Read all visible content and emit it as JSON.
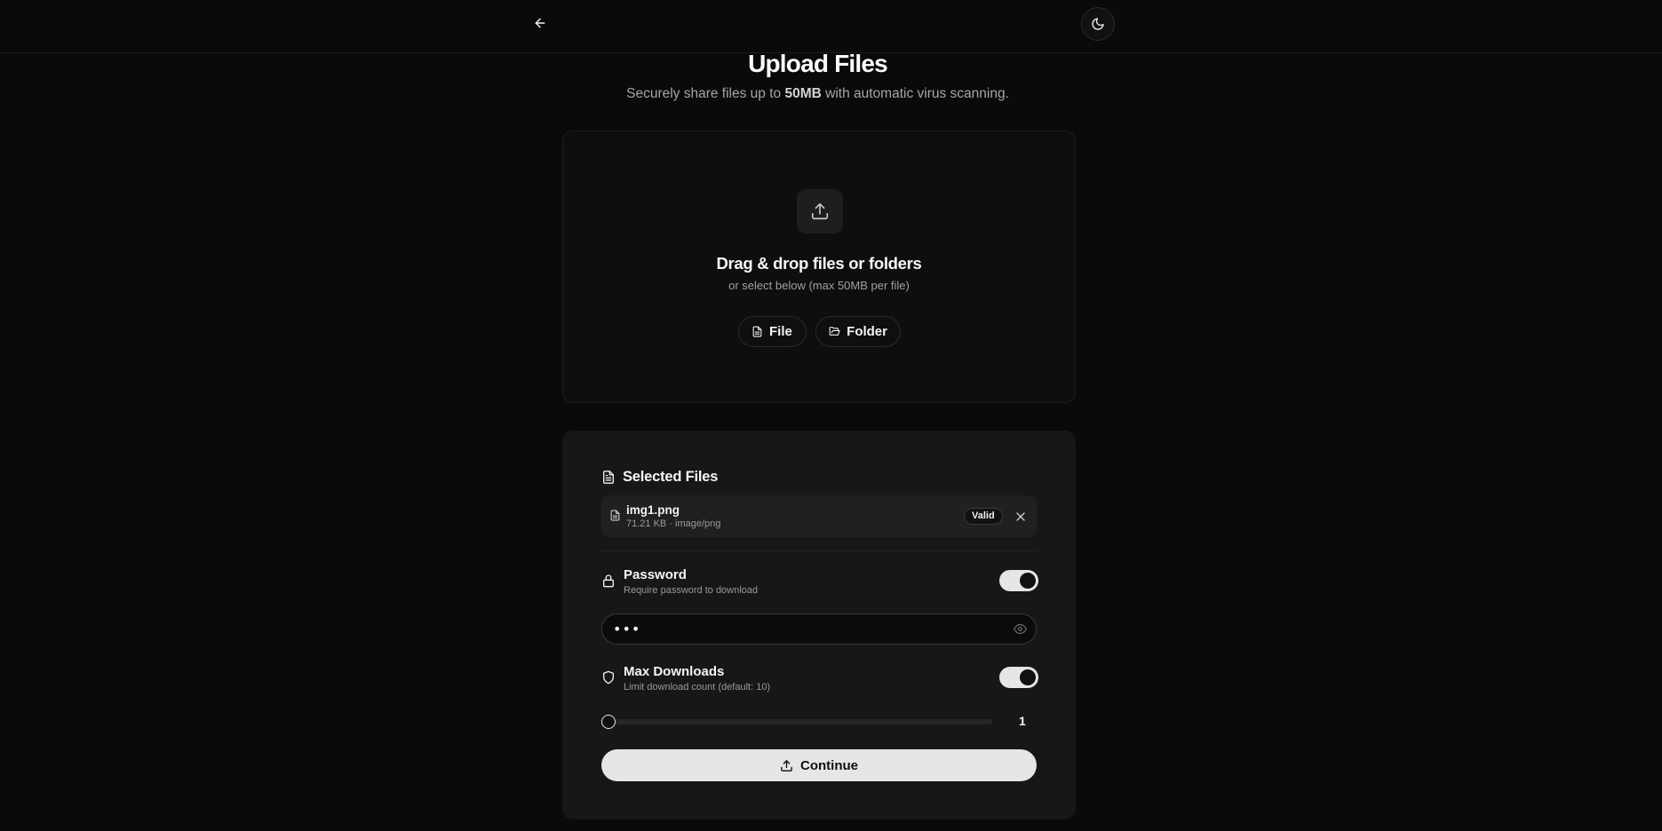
{
  "header": {
    "back_icon": "arrow-left-icon",
    "theme_icon": "moon-icon"
  },
  "page": {
    "title": "Upload Files",
    "subtitle_before": "Securely share files up to ",
    "subtitle_limit": "50MB",
    "subtitle_after": " with automatic virus scanning."
  },
  "dropzone": {
    "icon": "upload-icon",
    "title": "Drag & drop files or folders",
    "subtitle": "or select below (max 50MB per file)",
    "file_button": "File",
    "folder_button": "Folder"
  },
  "selected": {
    "heading": "Selected Files",
    "files": [
      {
        "name": "img1.png",
        "meta": "71.21 KB · image/png",
        "status": "Valid"
      }
    ]
  },
  "password": {
    "title": "Password",
    "description": "Require password to download",
    "enabled": true,
    "value": "abc"
  },
  "max_downloads": {
    "title": "Max Downloads",
    "description": "Limit download count (default: 10)",
    "enabled": true,
    "value": 1,
    "min": 1,
    "max": 100
  },
  "actions": {
    "continue_label": "Continue"
  },
  "colors": {
    "background": "#0a0a0a",
    "panel": "#171717",
    "accent": "#e6e6e6"
  }
}
